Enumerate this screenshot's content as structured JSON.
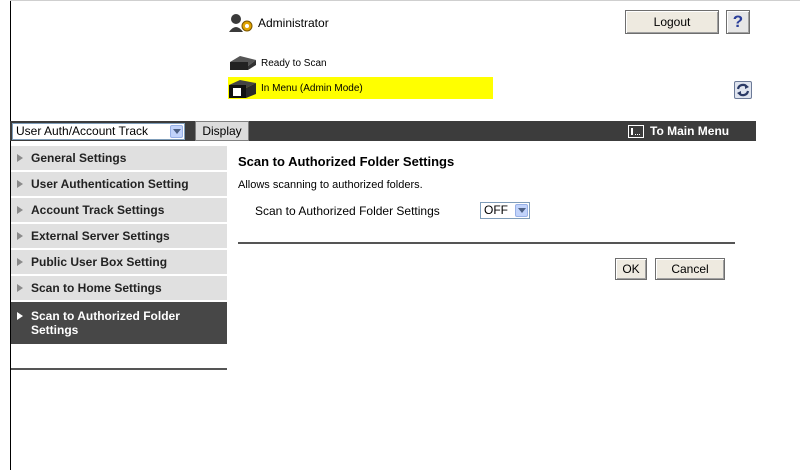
{
  "header": {
    "user_label": "Administrator",
    "logout_label": "Logout",
    "help_label": "?",
    "status_ready": "Ready to Scan",
    "status_menu": "In Menu (Admin Mode)"
  },
  "toolbar": {
    "mode_select_value": "User Auth/Account Track",
    "display_label": "Display",
    "main_menu_label": "To Main Menu"
  },
  "sidebar": {
    "items": [
      {
        "label": "General Settings"
      },
      {
        "label": "User Authentication Setting"
      },
      {
        "label": "Account Track Settings"
      },
      {
        "label": "External Server Settings"
      },
      {
        "label": "Public User Box Setting"
      },
      {
        "label": "Scan to Home Settings"
      },
      {
        "label": "Scan to Authorized Folder Settings"
      }
    ],
    "active_index": 6
  },
  "main": {
    "title": "Scan to Authorized Folder Settings",
    "description": "Allows scanning to authorized folders.",
    "setting_label": "Scan to Authorized Folder Settings",
    "setting_value": "OFF",
    "ok_label": "OK",
    "cancel_label": "Cancel"
  },
  "colors": {
    "status_highlight": "#ffff00",
    "bar_dark": "#3c3c3c",
    "sidebar_active": "#474747",
    "sidebar_item": "#e0e0e0"
  }
}
